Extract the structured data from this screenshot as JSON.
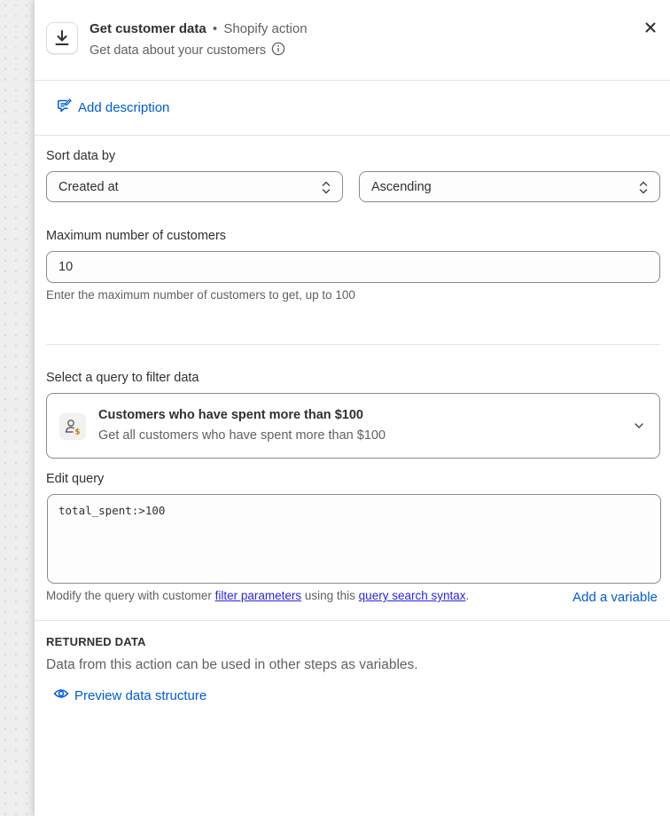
{
  "header": {
    "title": "Get customer data",
    "separator": "•",
    "source": "Shopify action",
    "subtitle": "Get data about your customers"
  },
  "description": {
    "add_label": "Add description"
  },
  "sort": {
    "label": "Sort data by",
    "field_value": "Created at",
    "order_value": "Ascending"
  },
  "max_customers": {
    "label": "Maximum number of customers",
    "value": "10",
    "help": "Enter the maximum number of customers to get, up to 100"
  },
  "query": {
    "label": "Select a query to filter data",
    "selected_title": "Customers who have spent more than $100",
    "selected_description": "Get all customers who have spent more than $100"
  },
  "edit_query": {
    "label": "Edit query",
    "value": "total_spent:>100",
    "help_prefix": "Modify the query with customer ",
    "help_link1": "filter parameters",
    "help_mid": " using this ",
    "help_link2": "query search syntax",
    "help_suffix": ".",
    "add_variable": "Add a variable"
  },
  "returned_data": {
    "heading": "RETURNED DATA",
    "text": "Data from this action can be used in other steps as variables.",
    "preview_label": "Preview data structure"
  },
  "colors": {
    "link": "#005bd3",
    "text": "#303030",
    "muted": "#616161",
    "border": "#8a8a8a",
    "inline_link": "#2b24e0"
  },
  "icons": {
    "action": "download-icon",
    "info": "info-icon",
    "close": "close-icon",
    "description": "comment-edit-icon",
    "select": "chevron-up-down-icon",
    "query": "customer-dollar-icon",
    "expand": "chevron-down-icon",
    "preview": "eye-icon"
  }
}
